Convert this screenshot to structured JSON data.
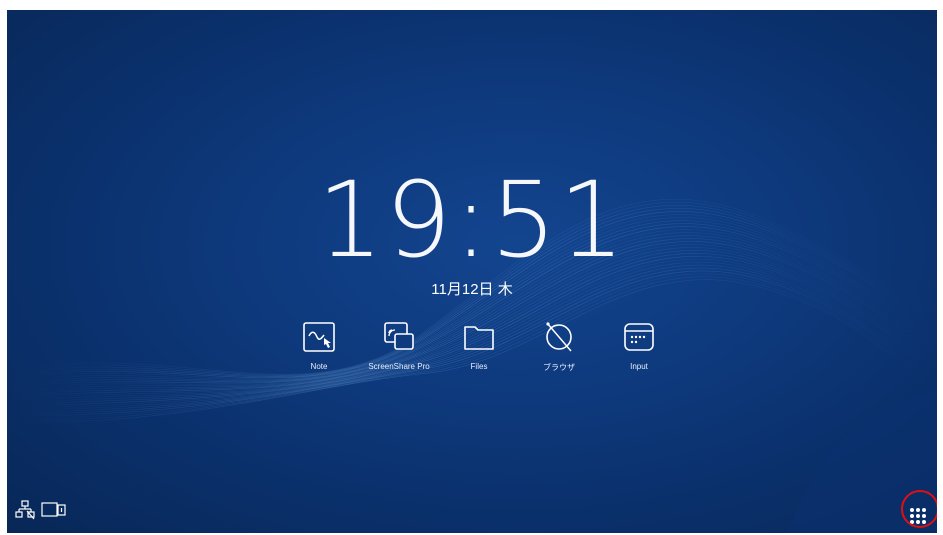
{
  "clock": {
    "time": "19:51",
    "date": "11月12日 木"
  },
  "apps": [
    {
      "label": "Note",
      "icon": "note-icon"
    },
    {
      "label": "ScreenShare Pro",
      "icon": "screenshare-icon"
    },
    {
      "label": "Files",
      "icon": "folder-icon"
    },
    {
      "label": "ブラウザ",
      "icon": "browser-icon"
    },
    {
      "label": "Input",
      "icon": "input-icon"
    }
  ],
  "status": {
    "icons": [
      "network-disconnected-icon",
      "display-signal-icon"
    ]
  },
  "app_drawer": {
    "icon": "app-grid-icon"
  },
  "colors": {
    "background": "#0e3a7e",
    "text": "#ffffff",
    "highlight_ring": "#e01010"
  }
}
